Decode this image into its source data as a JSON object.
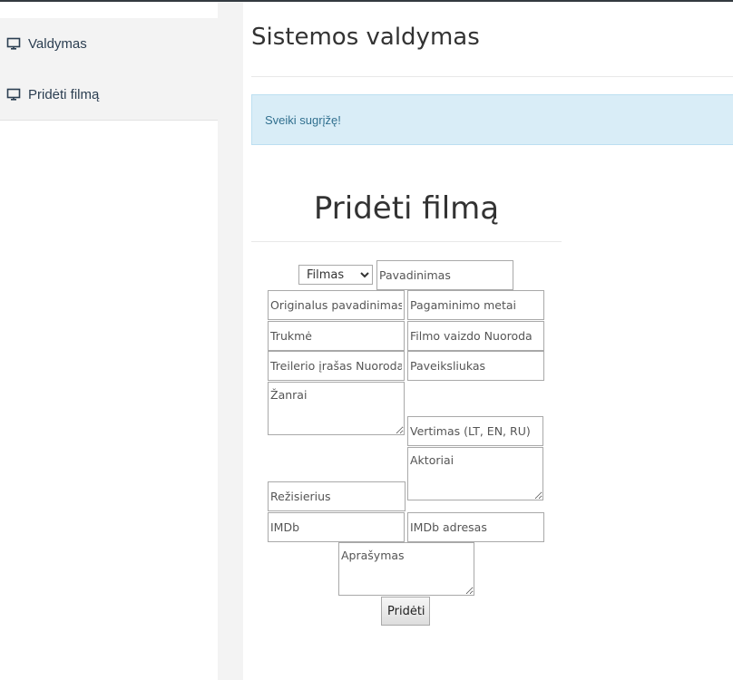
{
  "sidebar": {
    "items": [
      {
        "label": "Valdymas",
        "icon": "monitor-icon"
      },
      {
        "label": "Pridėti filmą",
        "icon": "monitor-icon"
      }
    ]
  },
  "header": {
    "title": "Sistemos valdymas"
  },
  "alert": {
    "text": "Sveiki sugrįžę!"
  },
  "form": {
    "title": "Pridėti filmą",
    "type_select": {
      "selected": "Filmas"
    },
    "placeholders": {
      "title": "Pavadinimas",
      "original_title": "Originalus pavadinimas",
      "year": "Pagaminimo metai",
      "duration": "Trukmė",
      "video_url": "Filmo vaizdo Nuoroda",
      "trailer_url": "Treilerio įrašas Nuoroda",
      "poster": "Paveiksliukas",
      "genres": "Žanrai",
      "translation": "Vertimas (LT, EN, RU)",
      "actors": "Aktoriai",
      "director": "Režisierius",
      "imdb": "IMDb",
      "imdb_url": "IMDb adresas",
      "description": "Aprašymas"
    },
    "submit_label": "Pridėti"
  },
  "colors": {
    "alert_bg": "#d9edf7",
    "alert_text": "#31708f",
    "sidebar_text": "#2b3e51",
    "sidebar_bg": "#f3f3f3"
  }
}
